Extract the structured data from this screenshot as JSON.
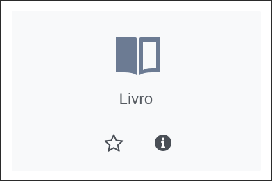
{
  "activity": {
    "title": "Livro",
    "icon": "book-open-icon",
    "icon_color": "#6c7b93"
  },
  "actions": {
    "star_icon": "star-outline-icon",
    "info_icon": "info-circle-icon",
    "icon_color": "#4a4f56"
  }
}
